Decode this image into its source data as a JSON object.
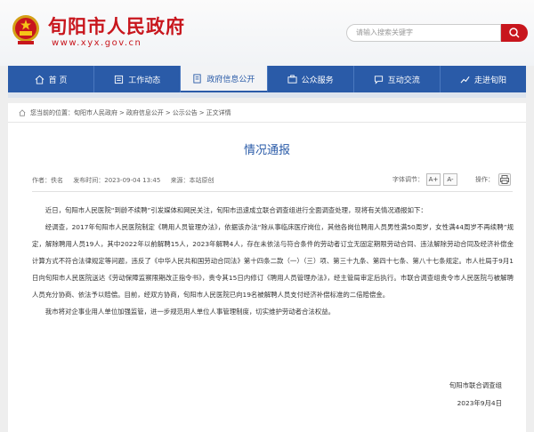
{
  "header": {
    "site_title": "旬阳市人民政府",
    "site_url": "www.xyx.gov.cn",
    "search_placeholder": "请输入搜索关键字"
  },
  "nav": {
    "items": [
      {
        "label": "首 页",
        "icon": "home-icon"
      },
      {
        "label": "工作动态",
        "icon": "news-icon"
      },
      {
        "label": "政府信息公开",
        "icon": "document-icon",
        "active": true
      },
      {
        "label": "公众服务",
        "icon": "service-icon"
      },
      {
        "label": "互动交流",
        "icon": "chat-icon"
      },
      {
        "label": "走进旬阳",
        "icon": "trend-icon"
      }
    ]
  },
  "breadcrumb": {
    "prefix": "您当前的位置：",
    "items": [
      "旬阳市人民政府",
      "政府信息公开",
      "公示公告",
      "正文详情"
    ],
    "sep": ">"
  },
  "article": {
    "title": "情况通报",
    "author": "作者：佚名",
    "date": "发布时间：2023-09-04 13:45",
    "source": "来源：本站原创",
    "font_size_label": "字体调节：",
    "font_plus": "A+",
    "font_minus": "A-",
    "print_label": "操作：",
    "paragraphs": [
      "近日，旬阳市人民医院“到龄不续聘”引发媒体和网民关注，旬阳市迅速成立联合调查组进行全面调查处理，现将有关情况通报如下：",
      "经调查，2017年旬阳市人民医院制定《聘用人员管理办法》，依据该办法“除从事临床医疗岗位，其他各岗位聘用人员男性满50周岁，女性满44周岁不再续聘”规定，解除聘用人员19人，其中2022年以前解聘15人，2023年解聘4人，存在未依法与符合条件的劳动者订立无固定期限劳动合同、违法解除劳动合同及经济补偿金计算方式不符合法律规定等问题，违反了《中华人民共和国劳动合同法》第十四条二款（一）（三）项、第三十九条、第四十七条、第八十七条规定。市人社局于9月1日向旬阳市人民医院送达《劳动保障监察限期改正指令书》，责令其15日内修订《聘用人员管理办法》，经主管局审定后执行。市联合调查组责令市人民医院与被解聘人员充分协商、依法予以赔偿。目前，经双方协商，旬阳市人民医院已向19名被解聘人员支付经济补偿标准的二倍赔偿金。",
      "我市将对企事业用人单位加强监管，进一步规范用人单位人事管理制度，切实维护劳动者合法权益。"
    ],
    "signature_org": "旬阳市联合调查组",
    "signature_date": "2023年9月4日"
  }
}
